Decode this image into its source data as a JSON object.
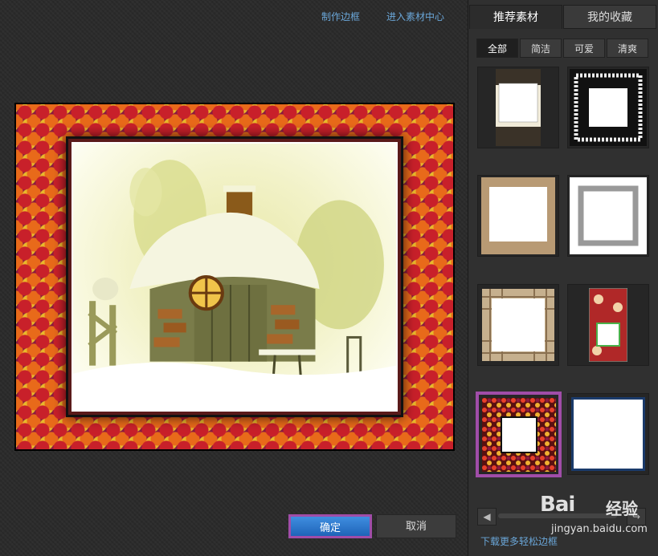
{
  "toolbar": {
    "make_frame": "制作边框",
    "enter_center": "进入素材中心"
  },
  "buttons": {
    "ok": "确定",
    "cancel": "取消"
  },
  "tabs": [
    {
      "label": "推荐素材",
      "active": true
    },
    {
      "label": "我的收藏",
      "active": false
    }
  ],
  "filters": [
    {
      "label": "全部",
      "active": true
    },
    {
      "label": "简洁",
      "active": false
    },
    {
      "label": "可爱",
      "active": false
    },
    {
      "label": "清爽",
      "active": false
    }
  ],
  "thumbnails": [
    {
      "name": "damask-strip-frame"
    },
    {
      "name": "white-lace-frame"
    },
    {
      "name": "vintage-paper-frame"
    },
    {
      "name": "stamp-edge-frame"
    },
    {
      "name": "plaid-frame"
    },
    {
      "name": "cupcake-frame"
    },
    {
      "name": "candy-frame",
      "selected": true
    },
    {
      "name": "blue-border-frame"
    }
  ],
  "download_link": "下载更多轻松边框",
  "watermark": {
    "brand": "Bai",
    "jy": "经验",
    "url": "jingyan.baidu.com"
  },
  "colors": {
    "accent": "#3f8ee0",
    "selection": "#a04da8",
    "link": "#6aa6d8"
  }
}
